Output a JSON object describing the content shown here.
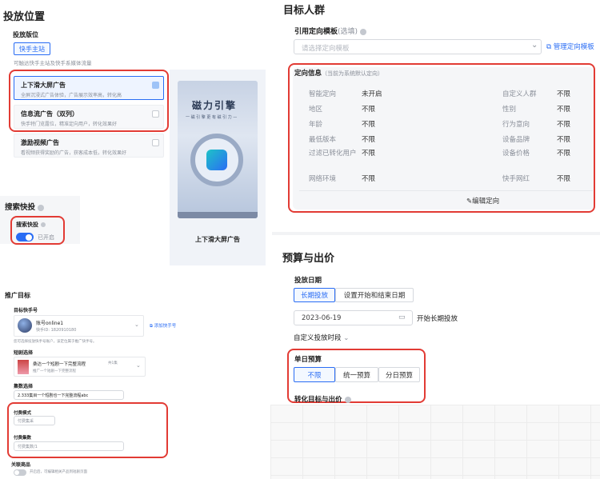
{
  "placement": {
    "title": "投放位置",
    "section_label": "投放版位",
    "app_button": "快手主站",
    "app_hint": "可触达快手主站及快手系媒体流量",
    "options": [
      {
        "title": "上下滑大屏广告",
        "desc": "全屏沉浸式广告体验，广告展示效率高，转化高",
        "checked": true
      },
      {
        "title": "信息流广告（双列）",
        "desc": "快手特门览露位，精准定向用户，转化效果好",
        "checked": false
      },
      {
        "title": "激励视频广告",
        "desc": "看视频获得奖励的广告，获客成本低，转化效果好",
        "checked": false
      }
    ],
    "preview": {
      "brand": "磁力引擎",
      "subtitle": "一 磁 引 擎 更 有 磁 引 力 —",
      "caption": "上下滑大屏广告"
    }
  },
  "search": {
    "title": "搜索快投",
    "toggle_label": "搜索快投",
    "toggle_state": "已开启"
  },
  "promo": {
    "title": "推广目标",
    "account_label": "目标快手号",
    "account_name": "账号online1",
    "account_id": "快手ID: 1820910180",
    "add_account": "添加快手号",
    "account_hint": "您可选择投放快手号账户，该定位属于推广快手号。",
    "short_label": "短剧选择",
    "short_name": "桑达一个短剧一下完整流程",
    "short_count": "共1集",
    "short_sub": "推广一个短剧一下完整流程",
    "episode_label": "集数选择",
    "episode_value": "2.333集目一个短剧也一下完整流程abc",
    "pay_label": "付费模式",
    "pay_placeholder": "付费集采",
    "pay_ep_label": "付费集数",
    "pay_ep_placeholder": "付费集数/1",
    "link_label": "关联商品",
    "link_hint": "开启后，可编辑相关产品到短剧页面"
  },
  "targeting": {
    "title": "目标人群",
    "template_label": "引用定向模板",
    "template_optional": "(选填)",
    "template_placeholder": "请选择定向模板",
    "manage": "管理定向模板",
    "info_title": "定向信息",
    "info_note": "（当前为系统默认定向）",
    "rows": [
      [
        "智能定向",
        "未开启",
        "自定义人群",
        "不限"
      ],
      [
        "地区",
        "不限",
        "性别",
        "不限"
      ],
      [
        "年龄",
        "不限",
        "行为意向",
        "不限"
      ],
      [
        "最低版本",
        "不限",
        "设备品牌",
        "不限"
      ],
      [
        "过滤已转化用户",
        "不限",
        "设备价格",
        "不限"
      ],
      [
        "网络环境",
        "不限",
        "快手网红",
        "不限"
      ]
    ],
    "edit": "编辑定向"
  },
  "budget": {
    "title": "预算与出价",
    "date_label": "投放日期",
    "long_term": "长期投放",
    "set_dates": "设置开始和结束日期",
    "date_value": "2023-06-19",
    "start_text": "开始长期投放",
    "custom_time": "自定义投放时段",
    "daily_label": "单日预算",
    "opts": [
      "不限",
      "统一预算",
      "分日预算"
    ],
    "goal_label": "转化目标与出价"
  },
  "colors": {
    "accent": "#2a6df4",
    "highlight": "#e23b34"
  }
}
